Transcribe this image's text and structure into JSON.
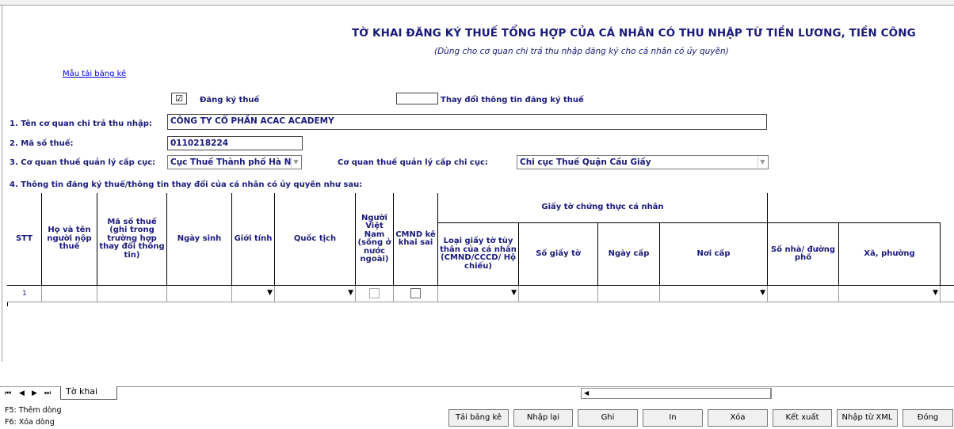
{
  "header": {
    "title": "TỜ KHAI ĐĂNG KÝ THUẾ TỔNG HỢP CỦA CÁ NHÂN CÓ THU NHẬP TỪ TIỀN LƯƠNG, TIỀN CÔNG",
    "subtitle": "(Dùng cho cơ quan chi trả thu nhập đăng ký cho cá nhân có ủy quyền)",
    "template_link": "Mẫu tải bảng kê"
  },
  "options": {
    "register_label": "Đăng ký thuế",
    "register_checked": "☑",
    "change_label": "Thay đổi thông tin đăng ký thuế"
  },
  "form": {
    "org_label": "1. Tên cơ quan chi trả thu nhập:",
    "org_value": "CÔNG TY CỔ PHẦN ACAC ACADEMY",
    "tax_code_label": "2. Mã số thuế:",
    "tax_code_value": "0110218224",
    "dept_label": "3. Cơ quan thuế quản lý cấp cục:",
    "dept_value": "Cục Thuế Thành phố Hà Nộ",
    "sub_dept_label": "Cơ quan thuế quản lý cấp chi cục:",
    "sub_dept_value": "Chi cục Thuế Quận Cầu Giấy",
    "section4_label": "4. Thông tin đăng ký thuế/thông tin thay đổi của cá nhân có ủy quyền như sau:"
  },
  "table": {
    "group_header": "Giấy tờ chứng thực cá nhân",
    "columns": [
      "STT",
      "Họ và tên người nộp thuế",
      "Mã số thuế (ghi trong trường hợp thay đổi thông tin)",
      "Ngày sinh",
      "Giới tính",
      "Quốc tịch",
      "Người Việt Nam (sống ở nước ngoài)",
      "CMND kê khai sai",
      "Loại giấy tờ tùy thân của cá nhân (CMND/CCCD/ Hộ chiếu)",
      "Số giấy tờ",
      "Ngày cấp",
      "Nơi cấp",
      "Số nhà/ đường phố",
      "Xã, phường"
    ],
    "rows": [
      {
        "stt": "1"
      }
    ]
  },
  "sheet": {
    "tab_name": "Tờ khai"
  },
  "hints": [
    "F5: Thêm dòng",
    "F6: Xóa dòng"
  ],
  "buttons": [
    "Tải bảng kê",
    "Nhập lại",
    "Ghi",
    "In",
    "Xóa",
    "Kết xuất",
    "Nhập từ XML",
    "Đóng"
  ],
  "icons": {
    "dropdown": "▼",
    "nav_first": "⏮",
    "nav_prev": "◀",
    "nav_next": "▶",
    "nav_last": "⏭"
  }
}
